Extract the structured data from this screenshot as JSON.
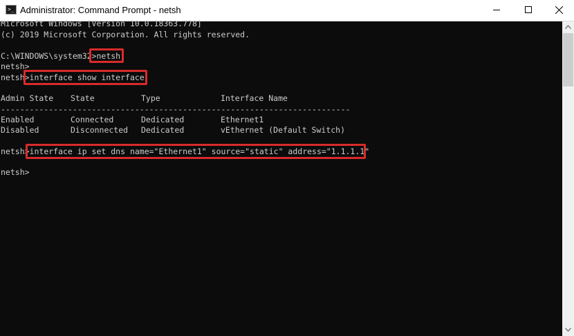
{
  "window": {
    "title": "Administrator: Command Prompt - netsh",
    "icon": "cmd-icon"
  },
  "console": {
    "header_line1": "Microsoft Windows [Version 10.0.18363.778]",
    "header_line2": "(c) 2019 Microsoft Corporation. All rights reserved.",
    "cmd1_prompt": "C:\\WINDOWS\\system32>",
    "cmd1_text": "netsh",
    "netsh_prompt_empty": "netsh>",
    "cmd2_prompt": "netsh>",
    "cmd2_text": "interface show interface",
    "table": {
      "headers": [
        "Admin State",
        "State",
        "Type",
        "Interface Name"
      ],
      "separator": "-------------------------------------------------------------------------",
      "rows": [
        [
          "Enabled",
          "Connected",
          "Dedicated",
          "Ethernet1"
        ],
        [
          "Disabled",
          "Disconnected",
          "Dedicated",
          "vEthernet (Default Switch)"
        ]
      ]
    },
    "cmd3_prompt": "netsh>",
    "cmd3_text": "interface ip set dns name=\"Ethernet1\" source=\"static\" address=\"1.1.1.1\"",
    "final_prompt": "netsh>"
  },
  "colors": {
    "background": "#0c0c0c",
    "text": "#cccccc",
    "highlight": "#d92b2b"
  }
}
